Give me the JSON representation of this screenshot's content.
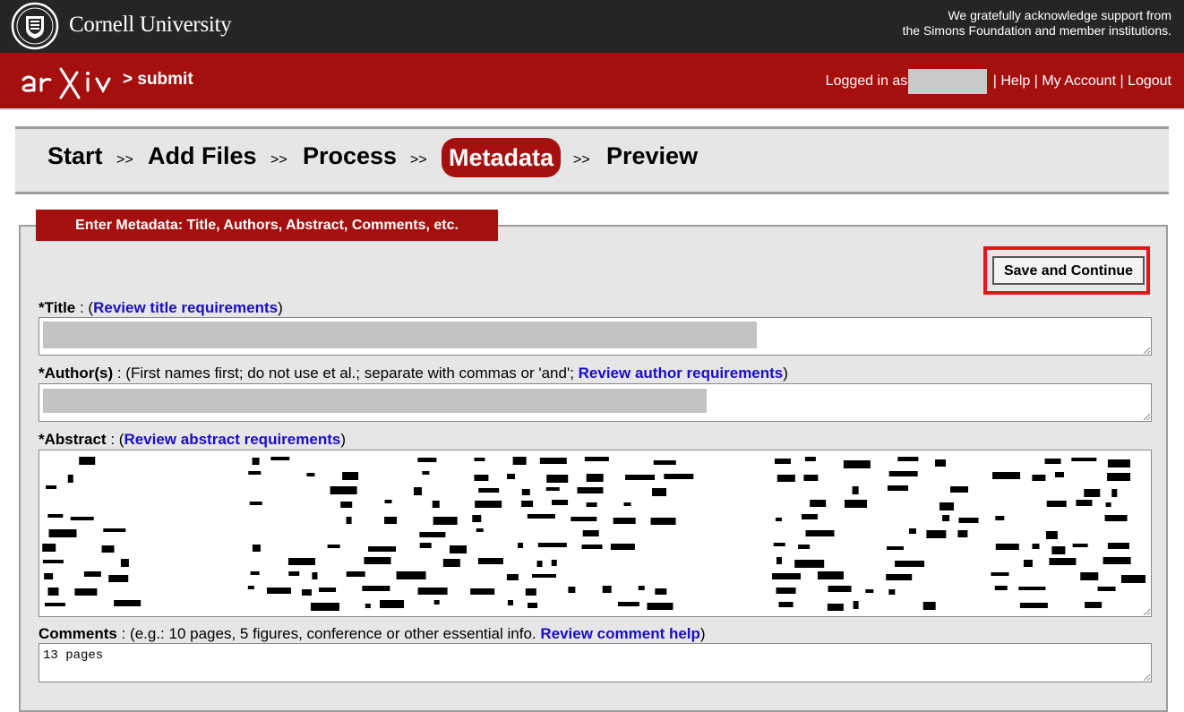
{
  "header": {
    "university": "Cornell University",
    "support_line1": "We gratefully acknowledge support from",
    "support_line2": "the Simons Foundation and member institutions."
  },
  "arxiv_bar": {
    "crumb": "> submit",
    "logged_in": "Logged in as",
    "help": "Help",
    "my_account": "My Account",
    "logout": "Logout",
    "separator": " | "
  },
  "steps": [
    {
      "label": "Start"
    },
    {
      "label": "Add Files"
    },
    {
      "label": "Process"
    },
    {
      "label": "Metadata",
      "active": true
    },
    {
      "label": "Preview"
    }
  ],
  "step_separator": ">>",
  "form": {
    "legend": "Enter Metadata: Title, Authors, Abstract, Comments, etc.",
    "save_label": "Save and Continue",
    "title": {
      "label": "*Title",
      "pre": " : (",
      "link": "Review title requirements",
      "post": ")"
    },
    "authors": {
      "label": "*Author(s)",
      "pre": " : (First names first; do not use et al.; separate with commas or 'and'; ",
      "link": "Review author requirements",
      "post": ")"
    },
    "abstract": {
      "label": "*Abstract",
      "pre": " : (",
      "link": "Review abstract requirements",
      "post": ")"
    },
    "comments": {
      "label": "Comments",
      "pre": " : (e.g.: 10 pages, 5 figures, conference or other essential info. ",
      "link": "Review comment help",
      "post": ")",
      "value": "13 pages"
    }
  },
  "colors": {
    "arxiv_red": "#a5100f",
    "top_dark": "#252525",
    "link_blue": "#1a0dc8",
    "highlight_red": "#e01818"
  }
}
